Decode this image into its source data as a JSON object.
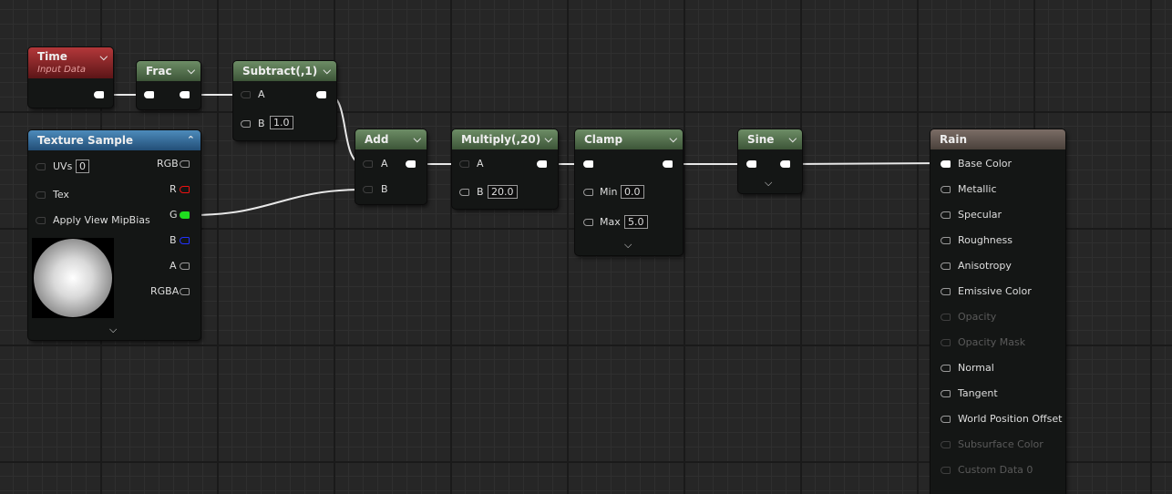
{
  "nodes": {
    "time": {
      "title": "Time",
      "subtitle": "Input Data"
    },
    "frac": {
      "title": "Frac"
    },
    "subtract": {
      "title": "Subtract(,1)",
      "pin_a": "A",
      "pin_b": "B",
      "b_value": "1.0"
    },
    "texture": {
      "title": "Texture Sample",
      "inputs": [
        "UVs",
        "Tex",
        "Apply View MipBias"
      ],
      "uvs_value": "0",
      "outputs": [
        "RGB",
        "R",
        "G",
        "B",
        "A",
        "RGBA"
      ]
    },
    "add": {
      "title": "Add",
      "pin_a": "A",
      "pin_b": "B"
    },
    "multiply": {
      "title": "Multiply(,20)",
      "pin_a": "A",
      "pin_b": "B",
      "b_value": "20.0"
    },
    "clamp": {
      "title": "Clamp",
      "min_label": "Min",
      "min_value": "0.0",
      "max_label": "Max",
      "max_value": "5.0"
    },
    "sine": {
      "title": "Sine"
    },
    "rain": {
      "title": "Rain",
      "inputs": [
        {
          "label": "Base Color",
          "enabled": true
        },
        {
          "label": "Metallic",
          "enabled": true
        },
        {
          "label": "Specular",
          "enabled": true
        },
        {
          "label": "Roughness",
          "enabled": true
        },
        {
          "label": "Anisotropy",
          "enabled": true
        },
        {
          "label": "Emissive Color",
          "enabled": true
        },
        {
          "label": "Opacity",
          "enabled": false
        },
        {
          "label": "Opacity Mask",
          "enabled": false
        },
        {
          "label": "Normal",
          "enabled": true
        },
        {
          "label": "Tangent",
          "enabled": true
        },
        {
          "label": "World Position Offset",
          "enabled": true
        },
        {
          "label": "Subsurface Color",
          "enabled": false
        },
        {
          "label": "Custom Data 0",
          "enabled": false
        }
      ]
    }
  },
  "colors": {
    "wire": "#e8e8e8",
    "g_pin": "#1fdc1f",
    "r_pin": "#ee1111",
    "b_pin": "#2233ff"
  },
  "icons": {
    "collapse": "chevron-down-icon",
    "expand": "chevron-up-icon"
  }
}
